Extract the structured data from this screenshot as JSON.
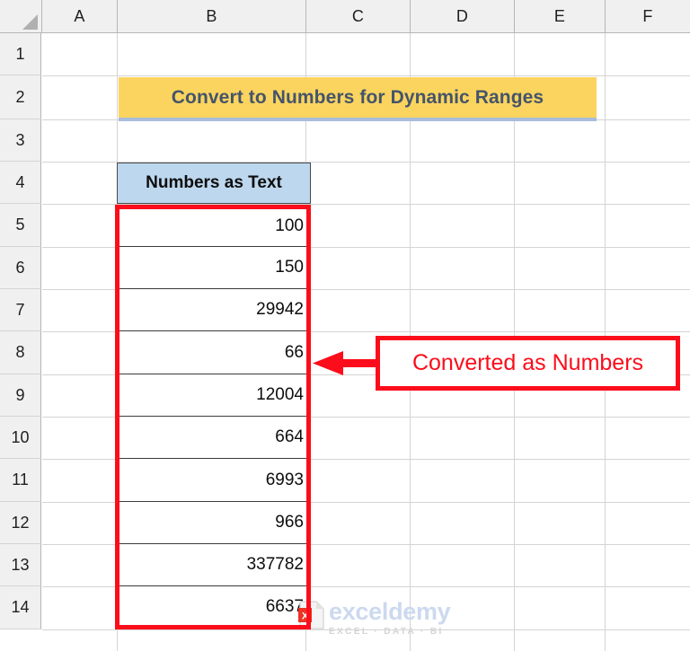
{
  "app": {
    "type": "spreadsheet",
    "column_headers": [
      "A",
      "B",
      "C",
      "D",
      "E",
      "F"
    ],
    "row_headers": [
      "1",
      "2",
      "3",
      "4",
      "5",
      "6",
      "7",
      "8",
      "9",
      "10",
      "11",
      "12",
      "13",
      "14"
    ]
  },
  "title": {
    "text": "Convert to Numbers for Dynamic Ranges",
    "background_color": "#fbd45f",
    "text_color": "#44546a",
    "underline_color": "#a8bcdc",
    "cell": "B2"
  },
  "table": {
    "header": {
      "label": "Numbers as Text",
      "background_color": "#bdd7ee",
      "cell": "B4"
    },
    "rows": [
      {
        "row": "5",
        "value": "100"
      },
      {
        "row": "6",
        "value": "150"
      },
      {
        "row": "7",
        "value": "29942"
      },
      {
        "row": "8",
        "value": "66"
      },
      {
        "row": "9",
        "value": "12004"
      },
      {
        "row": "10",
        "value": "664"
      },
      {
        "row": "11",
        "value": "6993"
      },
      {
        "row": "12",
        "value": "966"
      },
      {
        "row": "13",
        "value": "337782"
      },
      {
        "row": "14",
        "value": "6637"
      }
    ]
  },
  "annotation": {
    "highlight_color": "#fc0d1b",
    "callout_text": "Converted as Numbers",
    "arrow": "left-arrow-icon"
  },
  "watermark": {
    "name": "exceldemy",
    "tagline": "EXCEL · DATA · BI"
  }
}
